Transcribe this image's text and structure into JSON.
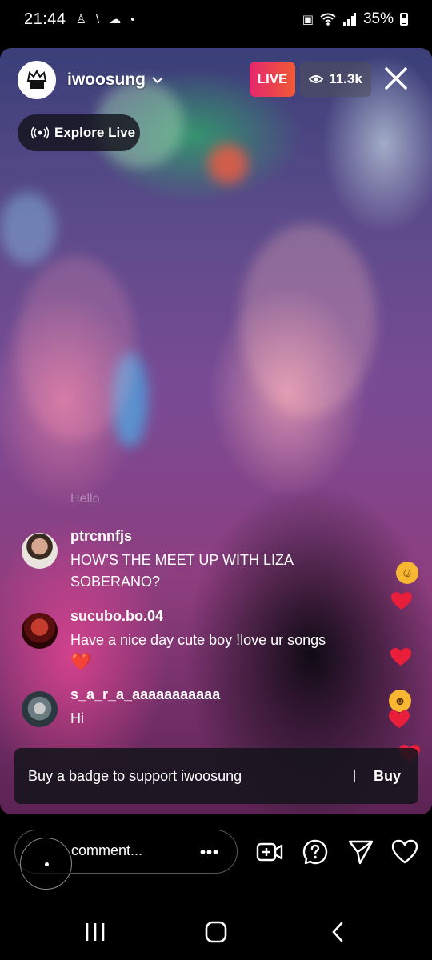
{
  "status_bar": {
    "time": "21:44",
    "battery": "35%",
    "icons": [
      "person-icon",
      "bluetooth-icon",
      "cloud-icon",
      "dot-icon",
      "vibrate-icon",
      "wifi-icon",
      "signal-icon",
      "battery-icon"
    ]
  },
  "live": {
    "host_username": "iwoosung",
    "live_label": "LIVE",
    "viewer_count": "11.3k",
    "explore_label": "Explore Live",
    "badge_color_start": "#e5276f",
    "badge_color_end": "#f05a34"
  },
  "comments": {
    "faded": "Hello",
    "items": [
      {
        "username": "ptrcnnfjs",
        "text": "HOW’S THE MEET UP WITH LIZA SOBERANO?"
      },
      {
        "username": "sucubo.bo.04",
        "text": "Have a nice day cute boy !love ur songs",
        "emoji": "❤️"
      },
      {
        "username": "s_a_r_a_aaaaaaaaaaa",
        "text": "Hi"
      }
    ]
  },
  "badge_banner": {
    "text": "Buy a badge to support iwoosung",
    "button": "Buy"
  },
  "bottom_bar": {
    "comment_placeholder": "comment...",
    "more_label": "•••",
    "icons": [
      "add-video-icon",
      "question-icon",
      "send-icon",
      "heart-icon"
    ]
  },
  "nav_bar": {
    "icons": [
      "recent-apps-icon",
      "home-icon",
      "back-icon"
    ]
  }
}
